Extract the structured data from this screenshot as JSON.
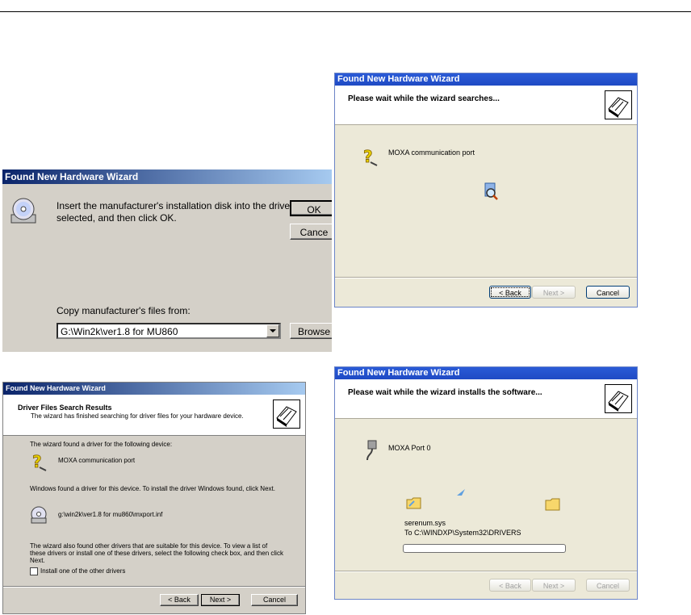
{
  "disk_dialog": {
    "title": "Found New Hardware Wizard",
    "message_line1": "Insert the manufacturer's installation disk into the drive",
    "message_line2": "selected, and then click OK.",
    "ok_label": "OK",
    "cancel_label": "Cance",
    "copy_label": "Copy manufacturer's files from:",
    "path_value": "G:\\Win2k\\ver1.8 for MU860",
    "browse_label": "Browse"
  },
  "search_wizard": {
    "title": "Found New Hardware Wizard",
    "header": "Please wait while the wizard searches...",
    "device_name": "MOXA communication port",
    "back_label": "< Back",
    "next_label": "Next >",
    "cancel_label": "Cancel"
  },
  "results_wizard": {
    "title": "Found New Hardware Wizard",
    "header_title": "Driver Files Search Results",
    "header_subtitle": "The wizard has finished searching for driver files for your hardware device.",
    "found_text": "The wizard found a driver for the following device:",
    "device_name": "MOXA communication port",
    "windows_found_text": "Windows found a driver for this device. To install the driver Windows found, click Next.",
    "driver_path": "g:\\win2k\\ver1.8 for mu860\\mxport.inf",
    "other_line1": "The wizard also found other drivers that are suitable for this device. To view a list of",
    "other_line2": "these drivers or install one of these drivers, select the following check box, and then click",
    "other_line3": "Next.",
    "checkbox_label": "Install one of the other drivers",
    "back_label": "< Back",
    "next_label": "Next >",
    "cancel_label": "Cancel"
  },
  "install_wizard": {
    "title": "Found New Hardware Wizard",
    "header": "Please wait while the wizard installs the software...",
    "device_name": "MOXA Port 0",
    "file_name": "serenum.sys",
    "destination": "To C:\\WINDXP\\System32\\DRIVERS",
    "progress": 0,
    "back_label": "< Back",
    "next_label": "Next >",
    "cancel_label": "Cancel"
  }
}
